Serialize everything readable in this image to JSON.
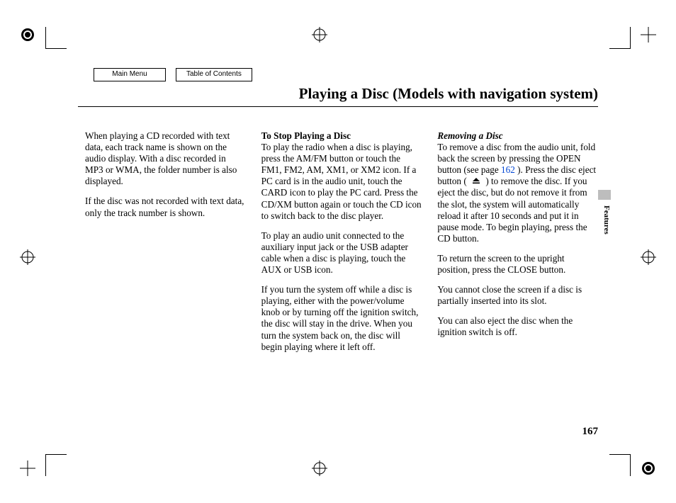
{
  "nav": {
    "main_menu": "Main Menu",
    "toc": "Table of Contents"
  },
  "title": "Playing a Disc (Models with navigation system)",
  "col1": {
    "p1": "When playing a CD recorded with text data, each track name is shown on the audio display. With a disc recorded in MP3 or WMA, the folder number is also displayed.",
    "p2": "If the disc was not recorded with text data, only the track number is shown."
  },
  "col2": {
    "h1": "To Stop Playing a Disc",
    "p1": "To play the radio when a disc is playing, press the AM/FM button or touch the FM1, FM2, AM, XM1, or XM2 icon. If a PC card is in the audio unit, touch the CARD icon to play the PC card. Press the CD/XM button again or touch the CD icon to switch back to the disc player.",
    "p2": "To play an audio unit connected to the auxiliary input jack or the USB adapter cable when a disc is playing, touch the AUX or USB icon.",
    "p3": "If you turn the system off while a disc is playing, either with the power/volume knob or by turning off the ignition switch, the disc will stay in the drive. When you turn the system back on, the disc will begin playing where it left off."
  },
  "col3": {
    "h1": "Removing a Disc",
    "p1a": "To remove a disc from the audio unit, fold back the screen by pressing the OPEN button (see page ",
    "p1_link": "162",
    "p1b": " ). Press the disc eject button (",
    "p1c": ") to remove the disc. If you eject the disc, but do not remove it from the slot, the system will automatically reload it after 10 seconds and put it in pause mode. To begin playing, press the CD button.",
    "p2": "To return the screen to the upright position, press the CLOSE button.",
    "p3": "You cannot close the screen if a disc is partially inserted into its slot.",
    "p4": "You can also eject the disc when the ignition switch is off."
  },
  "side_label": "Features",
  "page_number": "167"
}
